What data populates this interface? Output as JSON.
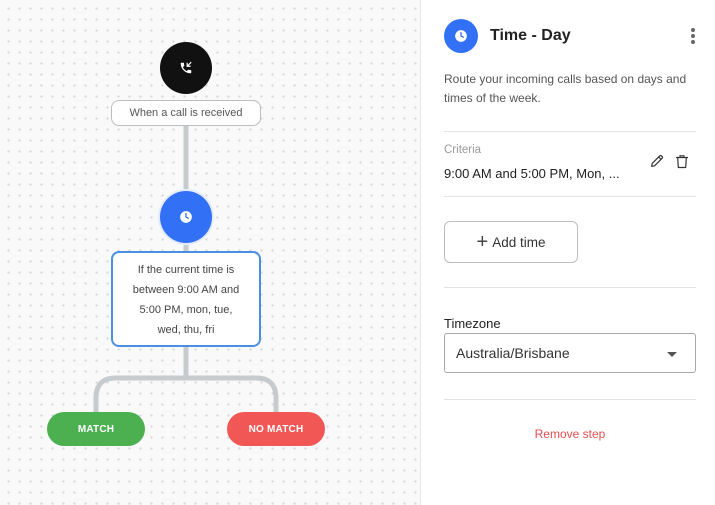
{
  "canvas": {
    "trigger": {
      "label": "When a call is received",
      "icon": "phone-incoming-icon"
    },
    "time_node": {
      "icon": "clock-icon"
    },
    "condition": {
      "lines": [
        "If the current time is",
        "between 9:00 AM and",
        "5:00 PM, mon, tue,",
        "wed, thu, fri"
      ]
    },
    "match_label": "MATCH",
    "no_match_label": "NO MATCH",
    "colors": {
      "match": "#4caf50",
      "no_match": "#f15755",
      "accent": "#3270f5",
      "connector": "#c5cbcf",
      "condition_border": "#4a90e2"
    }
  },
  "panel": {
    "title": "Time - Day",
    "header_icon": "clock-icon",
    "description": "Route your incoming calls based on days and times of the week.",
    "criteria_label": "Criteria",
    "criteria_value": "9:00 AM and 5:00 PM, Mon, ...",
    "add_time_label": "Add time",
    "timezone_label": "Timezone",
    "timezone_value": "Australia/Brisbane",
    "remove_step_label": "Remove step",
    "remove_color": "#e34f4f"
  }
}
